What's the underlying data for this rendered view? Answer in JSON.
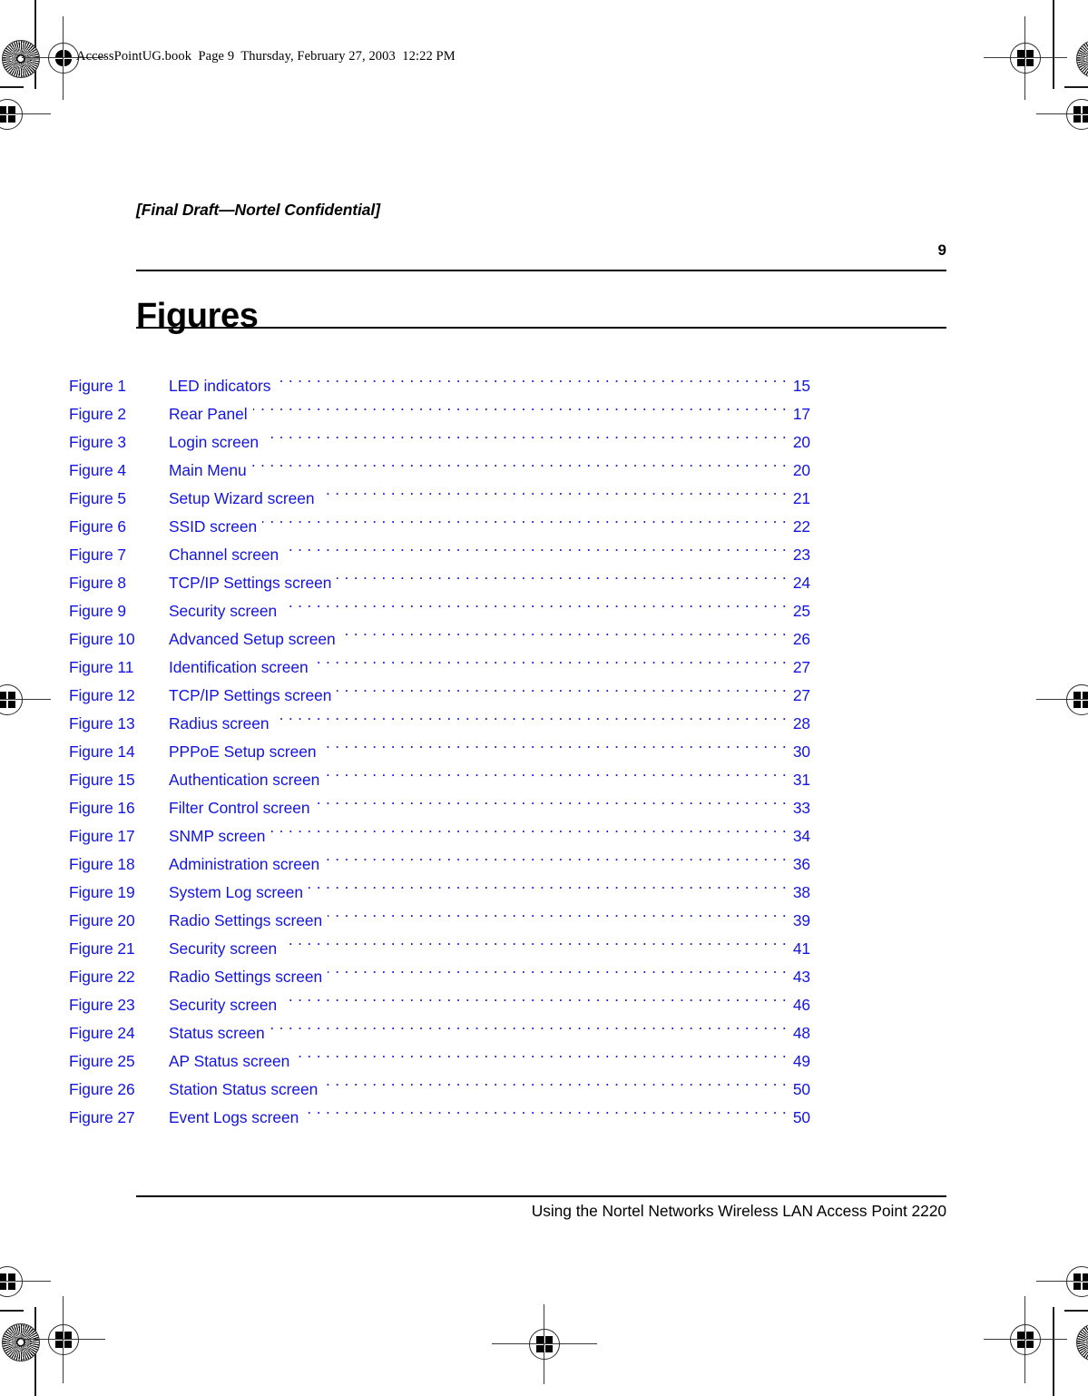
{
  "print_header": {
    "text": "AccessPointUG.book  Page 9  Thursday, February 27, 2003  12:22 PM"
  },
  "draft_marker": "[Final Draft—Nortel Confidential]",
  "folio": "9",
  "chapter_title": "Figures",
  "footer": "Using the Nortel Networks Wireless LAN Access Point 2220",
  "colors": {
    "toc_link": "#1414e6",
    "text": "#000000",
    "rule": "#000000",
    "background": "#ffffff"
  },
  "toc": {
    "entries": [
      {
        "label": "Figure 1",
        "title": "LED indicators",
        "page": "15"
      },
      {
        "label": "Figure 2",
        "title": "Rear Panel",
        "page": "17"
      },
      {
        "label": "Figure 3",
        "title": "Login screen",
        "page": "20"
      },
      {
        "label": "Figure 4",
        "title": "Main Menu",
        "page": "20"
      },
      {
        "label": "Figure 5",
        "title": "Setup Wizard screen",
        "page": "21"
      },
      {
        "label": "Figure 6",
        "title": "SSID screen",
        "page": "22"
      },
      {
        "label": "Figure 7",
        "title": "Channel screen",
        "page": "23"
      },
      {
        "label": "Figure 8",
        "title": "TCP/IP Settings screen",
        "page": "24"
      },
      {
        "label": "Figure 9",
        "title": "Security screen",
        "page": "25"
      },
      {
        "label": "Figure 10",
        "title": "Advanced Setup screen",
        "page": "26"
      },
      {
        "label": "Figure 11",
        "title": "Identification screen",
        "page": "27"
      },
      {
        "label": "Figure 12",
        "title": "TCP/IP Settings screen",
        "page": "27"
      },
      {
        "label": "Figure 13",
        "title": "Radius screen",
        "page": "28"
      },
      {
        "label": "Figure 14",
        "title": "PPPoE Setup screen",
        "page": "30"
      },
      {
        "label": "Figure 15",
        "title": "Authentication screen",
        "page": "31"
      },
      {
        "label": "Figure 16",
        "title": "Filter Control screen",
        "page": "33"
      },
      {
        "label": "Figure 17",
        "title": "SNMP screen",
        "page": "34"
      },
      {
        "label": "Figure 18",
        "title": "Administration screen",
        "page": "36"
      },
      {
        "label": "Figure 19",
        "title": "System Log screen",
        "page": "38"
      },
      {
        "label": "Figure 20",
        "title": "Radio Settings screen",
        "page": "39"
      },
      {
        "label": "Figure 21",
        "title": "Security screen",
        "page": "41"
      },
      {
        "label": "Figure 22",
        "title": "Radio Settings screen",
        "page": "43"
      },
      {
        "label": "Figure 23",
        "title": "Security screen",
        "page": "46"
      },
      {
        "label": "Figure 24",
        "title": "Status screen",
        "page": "48"
      },
      {
        "label": "Figure 25",
        "title": "AP Status screen",
        "page": "49"
      },
      {
        "label": "Figure 26",
        "title": "Station Status screen",
        "page": "50"
      },
      {
        "label": "Figure 27",
        "title": "Event Logs screen",
        "page": "50"
      }
    ]
  },
  "proof_marks": {
    "registration_icon": "registration-target-icon",
    "rosette_icon": "color-rosette-icon",
    "trim_icon": "trim-line-icon"
  }
}
